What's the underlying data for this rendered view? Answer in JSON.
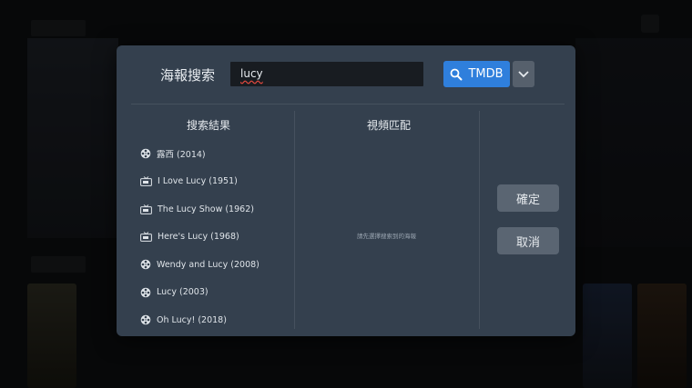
{
  "dialog": {
    "title": "海報搜索",
    "search": {
      "value": "lucy"
    },
    "search_button_label": "TMDB",
    "results_title": "搜索結果",
    "match_title": "視頻匹配",
    "match_hint": "請先選擇搜索到的海報",
    "results": [
      {
        "label": "露西 (2014)",
        "icon": "film-reel-icon"
      },
      {
        "label": "I Love Lucy (1951)",
        "icon": "tv-icon"
      },
      {
        "label": "The Lucy Show (1962)",
        "icon": "tv-icon"
      },
      {
        "label": "Here's Lucy (1968)",
        "icon": "tv-icon"
      },
      {
        "label": "Wendy and Lucy (2008)",
        "icon": "film-reel-icon"
      },
      {
        "label": "Lucy (2003)",
        "icon": "film-reel-icon"
      },
      {
        "label": "Oh Lucy! (2018)",
        "icon": "film-reel-icon"
      }
    ],
    "confirm_label": "確定",
    "cancel_label": "取消"
  },
  "colors": {
    "accent": "#2f7fdc",
    "dialog_bg": "#34404e",
    "button_gray": "#5a6572"
  }
}
